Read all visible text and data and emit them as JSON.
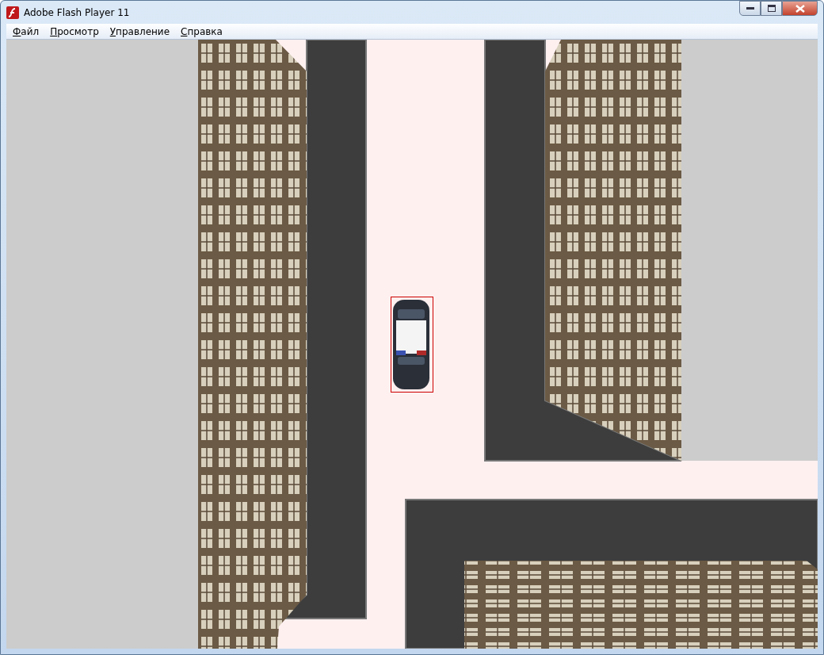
{
  "window": {
    "title": "Adobe Flash Player 11"
  },
  "menu": [
    "Файл",
    "Просмотр",
    "Управление",
    "Справка"
  ]
}
